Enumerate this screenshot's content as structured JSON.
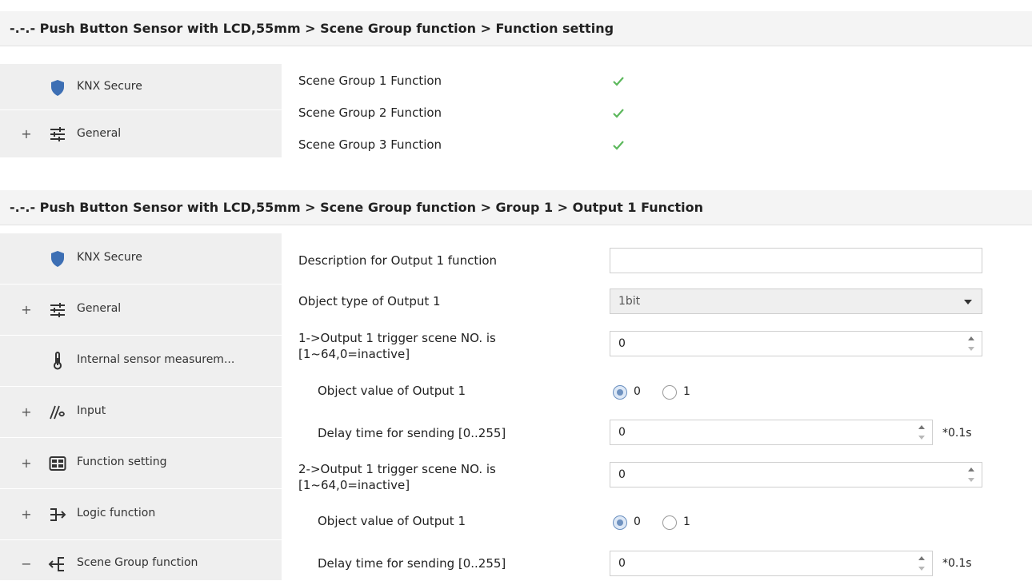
{
  "panel1": {
    "breadcrumb": "-.-.- Push Button Sensor with LCD,55mm > Scene Group function > Function setting",
    "sidebar": [
      {
        "label": "KNX Secure",
        "expander": "",
        "icon": "shield-icon"
      },
      {
        "label": "General",
        "expander": "+",
        "icon": "sliders-icon"
      }
    ],
    "options": [
      {
        "label": "Scene Group 1 Function",
        "checked": true
      },
      {
        "label": "Scene Group 2 Function",
        "checked": true
      },
      {
        "label": "Scene Group 3 Function",
        "checked": true
      }
    ]
  },
  "panel2": {
    "breadcrumb": "-.-.- Push Button Sensor with LCD,55mm > Scene Group function > Group 1 > Output 1 Function",
    "sidebar": [
      {
        "label": "KNX Secure",
        "expander": "",
        "icon": "shield-icon"
      },
      {
        "label": "General",
        "expander": "+",
        "icon": "sliders-icon"
      },
      {
        "label": "Internal sensor measurem...",
        "expander": "",
        "icon": "thermometer-icon"
      },
      {
        "label": "Input",
        "expander": "+",
        "icon": "input-icon"
      },
      {
        "label": "Function setting",
        "expander": "+",
        "icon": "grid-icon"
      },
      {
        "label": "Logic function",
        "expander": "+",
        "icon": "logic-icon"
      },
      {
        "label": "Scene Group function",
        "expander": "−",
        "icon": "scene-group-icon"
      }
    ],
    "fields": {
      "description_label": "Description for Output 1 function",
      "description_value": "",
      "object_type_label": "Object type of Output 1",
      "object_type_value": "1bit",
      "trigger1_label_line1": "1->Output 1 trigger scene NO. is",
      "trigger1_label_line2": "[1~64,0=inactive]",
      "trigger1_value": "0",
      "value1_label": "Object value of Output 1",
      "delay1_label": "Delay time for sending [0..255]",
      "delay1_value": "0",
      "trigger2_label_line1": "2->Output 1 trigger scene NO. is",
      "trigger2_label_line2": "[1~64,0=inactive]",
      "trigger2_value": "0",
      "value2_label": "Object value of Output 1",
      "delay2_label": "Delay time for sending [0..255]",
      "delay2_value": "0",
      "radio_option_0": "0",
      "radio_option_1": "1",
      "unit": "*0.1s"
    }
  },
  "colors": {
    "accent": "#3d6fb4",
    "check": "#5cb85c",
    "sidebar_bg": "#efefef"
  }
}
